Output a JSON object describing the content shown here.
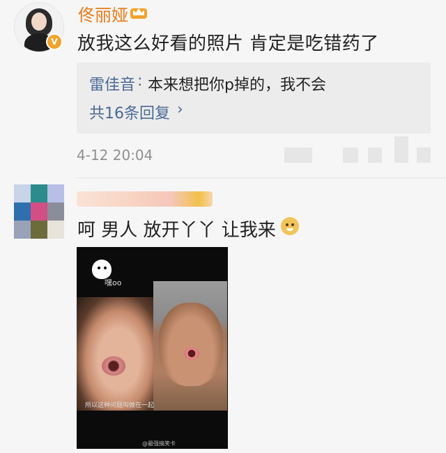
{
  "comment": {
    "username": "佟丽娅",
    "verified_badge": "V",
    "text": "放我这么好看的照片 肯定是吃错药了",
    "timestamp": "4-12 20:04"
  },
  "reply_preview": {
    "user": "雷佳音",
    "colon": ":",
    "text": "本来想把你p掉的，我不会",
    "count_label": "共16条回复",
    "chevron": "›"
  },
  "comment2": {
    "text": "呵 男人 放开丫丫 让我来",
    "emoji": "doge-emoji"
  },
  "image": {
    "sticker_caption": "嘿oo",
    "subtitle": "所以这种问题叫做在一起",
    "watermark": "@最强搞笑卡"
  },
  "colors": {
    "username": "#e97a19",
    "link": "#4a6a96",
    "text": "#222222",
    "muted": "#8f8f8f",
    "background": "#f6f6f6"
  }
}
